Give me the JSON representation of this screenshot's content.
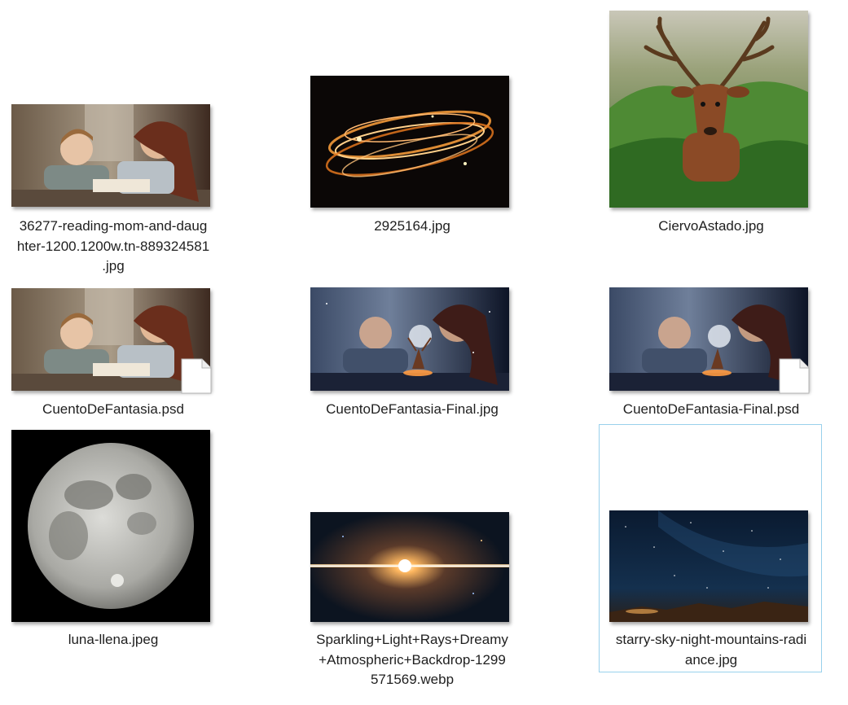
{
  "files": [
    {
      "name": "36277-reading-mom-and-daughter-1200.1200w.tn-889324581.jpg",
      "line1": "36277-reading-mom-and-daug",
      "line2": "hter-1200.1200w.tn-889324581",
      "line3": ".jpg"
    },
    {
      "name": "2925164.jpg",
      "line1": "2925164.jpg"
    },
    {
      "name": "CiervoAstado.jpg",
      "line1": "CiervoAstado.jpg"
    },
    {
      "name": "CuentoDeFantasia.psd",
      "line1": "CuentoDeFantasia.psd"
    },
    {
      "name": "CuentoDeFantasia-Final.jpg",
      "line1": "CuentoDeFantasia-Final.jpg"
    },
    {
      "name": "CuentoDeFantasia-Final.psd",
      "line1": "CuentoDeFantasia-Final.psd"
    },
    {
      "name": "luna-llena.jpeg",
      "line1": "luna-llena.jpeg"
    },
    {
      "name": "Sparkling+Light+Rays+Dreamy+Atmospheric+Backdrop-1299571569.webp",
      "line1": "Sparkling+Light+Rays+Dreamy",
      "line2": "+Atmospheric+Backdrop-1299",
      "line3": "571569.webp"
    },
    {
      "name": "starry-sky-night-mountains-radiance.jpg",
      "line1": "starry-sky-night-mountains-radi",
      "line2": "ance.jpg"
    }
  ],
  "selected_index": 8,
  "colors": {
    "selection_border": "#99d1ec",
    "text": "#1f1f1f"
  }
}
